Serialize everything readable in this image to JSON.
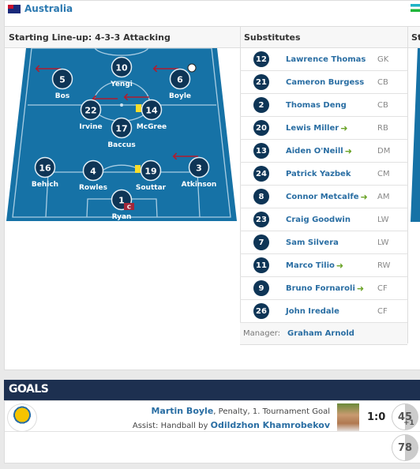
{
  "team": {
    "name": "Australia",
    "flag": "australia-flag"
  },
  "lineup": {
    "title": "Starting Line-up: 4-3-3 Attacking",
    "players": [
      {
        "number": "10",
        "name": "Yengi",
        "subbed_off": false
      },
      {
        "number": "5",
        "name": "Bos",
        "subbed_off": true
      },
      {
        "number": "6",
        "name": "Boyle",
        "subbed_off": true,
        "goal": true
      },
      {
        "number": "22",
        "name": "Irvine",
        "subbed_off": true
      },
      {
        "number": "14",
        "name": "McGree",
        "subbed_off": true,
        "yellow_card": true
      },
      {
        "number": "17",
        "name": "Baccus",
        "subbed_off": false
      },
      {
        "number": "16",
        "name": "Behich",
        "subbed_off": false
      },
      {
        "number": "4",
        "name": "Rowles",
        "subbed_off": false
      },
      {
        "number": "19",
        "name": "Souttar",
        "subbed_off": false,
        "yellow_card": true
      },
      {
        "number": "3",
        "name": "Atkinson",
        "subbed_off": true
      },
      {
        "number": "1",
        "name": "Ryan",
        "captain": true
      }
    ],
    "captain_label": "C",
    "pitch_color": "#1672a6"
  },
  "substitutes": {
    "title": "Substitutes",
    "rows": [
      {
        "number": "12",
        "name": "Lawrence Thomas",
        "pos": "GK",
        "in": false
      },
      {
        "number": "21",
        "name": "Cameron Burgess",
        "pos": "CB",
        "in": false
      },
      {
        "number": "2",
        "name": "Thomas Deng",
        "pos": "CB",
        "in": false
      },
      {
        "number": "20",
        "name": "Lewis Miller",
        "pos": "RB",
        "in": true
      },
      {
        "number": "13",
        "name": "Aiden O'Neill",
        "pos": "DM",
        "in": true
      },
      {
        "number": "24",
        "name": "Patrick Yazbek",
        "pos": "CM",
        "in": false
      },
      {
        "number": "8",
        "name": "Connor Metcalfe",
        "pos": "AM",
        "in": true
      },
      {
        "number": "23",
        "name": "Craig Goodwin",
        "pos": "LW",
        "in": false
      },
      {
        "number": "7",
        "name": "Sam Silvera",
        "pos": "LW",
        "in": false
      },
      {
        "number": "11",
        "name": "Marco Tilio",
        "pos": "RW",
        "in": true
      },
      {
        "number": "9",
        "name": "Bruno Fornaroli",
        "pos": "CF",
        "in": true
      },
      {
        "number": "26",
        "name": "John Iredale",
        "pos": "CF",
        "in": false
      }
    ],
    "manager_label": "Manager:",
    "manager": "Graham Arnold"
  },
  "other_team_header": "St",
  "goals": {
    "title": "GOALS",
    "items": [
      {
        "scorer": "Martin Boyle",
        "detail": ", Penalty, 1. Tournament Goal",
        "assist_prefix": "Assist: Handball by ",
        "assist": "Odildzhon Khamrobekov",
        "score": "1:0",
        "minute": "45",
        "added": "+1"
      }
    ],
    "other_minute": "78"
  }
}
